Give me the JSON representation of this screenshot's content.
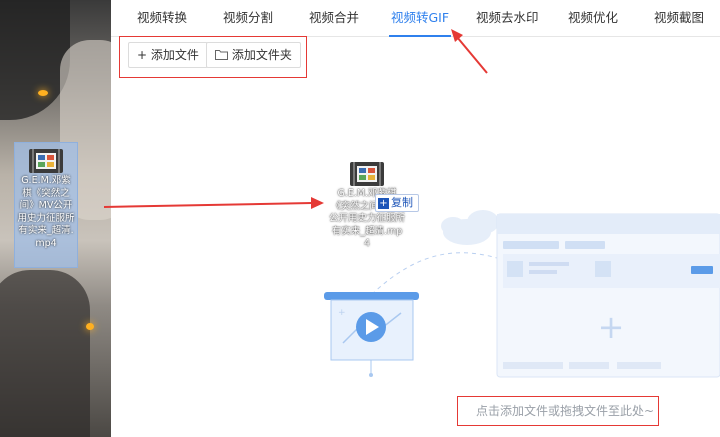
{
  "tabs": [
    {
      "label": "视频转换",
      "active": false
    },
    {
      "label": "视频分割",
      "active": false
    },
    {
      "label": "视频合并",
      "active": false
    },
    {
      "label": "视频转GIF",
      "active": true
    },
    {
      "label": "视频去水印",
      "active": false
    },
    {
      "label": "视频优化",
      "active": false
    },
    {
      "label": "视频截图",
      "active": false
    }
  ],
  "toolbar": {
    "add_file_icon": "+",
    "add_file_label": "添加文件",
    "add_folder_icon": "folder-icon",
    "add_folder_label": "添加文件夹"
  },
  "desktop_file": {
    "icon": "film-icon",
    "name": "G.E.M.邓紫棋《突然之间》MV公开用史力征服所有实来_超清.mp4"
  },
  "drag_ghost": {
    "icon": "film-icon",
    "name": "G.E.M.邓紫棋《突然之间》MV公开用史力征服所有实来_超清.mp4",
    "copy_label": "复制"
  },
  "empty_state": {
    "hint": "点击添加文件或拖拽文件至此处~",
    "illustration": "upload-illustration"
  },
  "colors": {
    "accent": "#2f80ed",
    "annotation_red": "#e53935",
    "illustration_blue": "#5b9be8",
    "illustration_light": "#e8f1fd"
  }
}
